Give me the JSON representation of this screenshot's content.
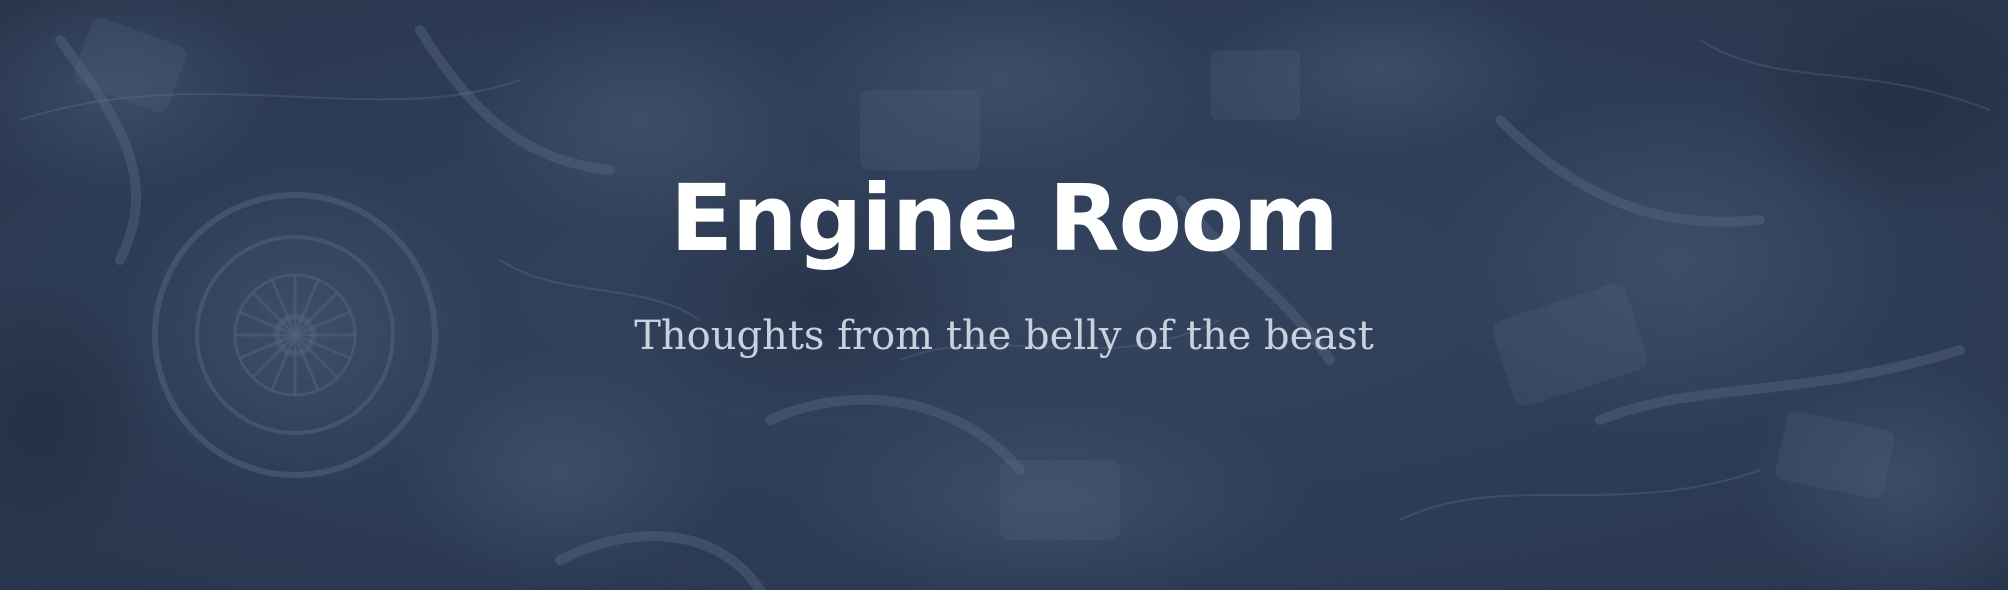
{
  "header": {
    "title": "Engine Room",
    "tagline": "Thoughts from the belly of the beast"
  },
  "colors": {
    "background": "#2e3d56",
    "title": "#ffffff",
    "tagline": "#c9d1dd"
  },
  "background_image": {
    "subject": "engine-parts-photo"
  }
}
